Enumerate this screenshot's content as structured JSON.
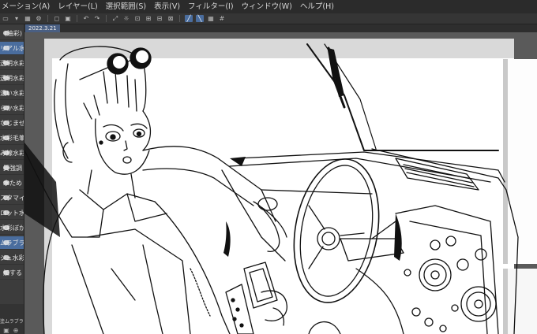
{
  "menubar": {
    "items": [
      "メーション(A)",
      "レイヤー(L)",
      "選択範囲(S)",
      "表示(V)",
      "フィルター(I)",
      "ウィンドウ(W)",
      "ヘルプ(H)"
    ]
  },
  "document_tab": {
    "label": "2022.3.21",
    "close": "×"
  },
  "brush_panel": {
    "items": [
      {
        "label": "(油彩)",
        "selected": false
      },
      {
        "label": "リアル水彩",
        "selected": true
      },
      {
        "label": "透明水彩",
        "selected": false
      },
      {
        "label": "透明水彩",
        "selected": false
      },
      {
        "label": "濃い水彩",
        "selected": false
      },
      {
        "label": "らか水彩",
        "selected": false
      },
      {
        "label": "なじませ",
        "selected": false
      },
      {
        "label": "水彩毛筆",
        "selected": false
      },
      {
        "label": "み線水彩",
        "selected": false
      },
      {
        "label": "質強調",
        "selected": false
      },
      {
        "label": "水ため",
        "selected": false
      },
      {
        "label": "スタマイズ",
        "selected": false
      },
      {
        "label": "ロット水彩",
        "selected": false
      },
      {
        "label": "水彩ぼかし",
        "selected": false
      },
      {
        "label": "ムラブラシ",
        "selected": true
      },
      {
        "label": "ジュ水彩",
        "selected": false
      },
      {
        "label": "加する",
        "selected": false
      }
    ],
    "footer_label": "塗ムラブラシ"
  },
  "colors": {
    "menubar_bg": "#2b2b2b",
    "panel_bg": "#3c3c3c",
    "selection": "#4a6d9e",
    "canvas_gutter": "#5a5a5a",
    "paper": "#ffffff"
  },
  "canvas": {
    "content": "lineart illustration of a girl with sunglasses on her head sitting in a car beside the steering wheel and dashboard"
  }
}
